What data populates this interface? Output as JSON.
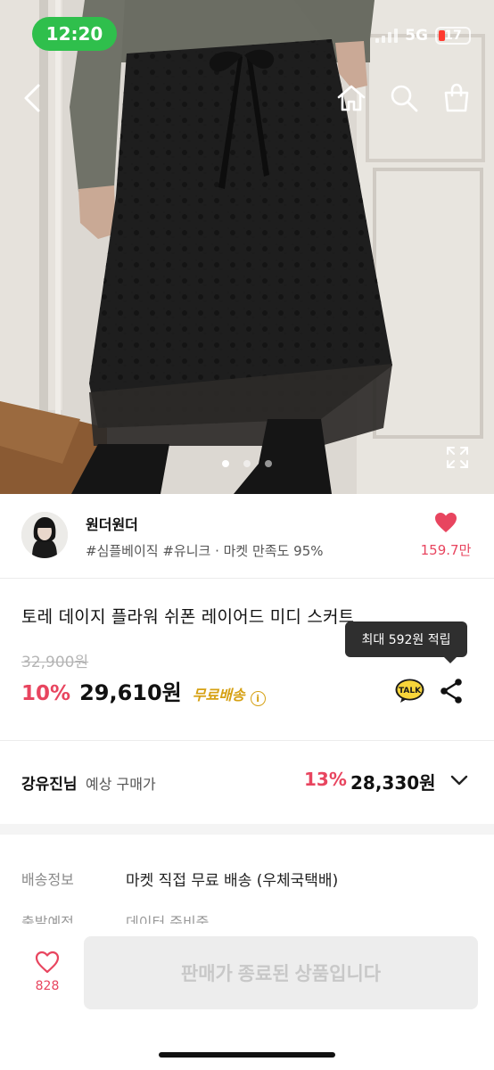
{
  "status_bar": {
    "time": "12:20",
    "network": "5G",
    "battery": "17"
  },
  "nav": {
    "back_icon": "chevron-left-icon",
    "home_icon": "home-icon",
    "search_icon": "search-icon",
    "cart_icon": "shopping-bag-icon"
  },
  "gallery": {
    "image_count": 3,
    "active_index": 0,
    "expand_icon": "expand-icon"
  },
  "seller": {
    "name": "원더원더",
    "tags": "#심플베이직 #유니크 · 마켓 만족도 95%",
    "likes": "159.7만"
  },
  "product": {
    "title": "토레 데이지 플라워 쉬폰 레이어드 미디 스커트",
    "original_price": "32,900원",
    "discount": "10%",
    "price": "29,610원",
    "shipping_badge": "무료배송",
    "points_tooltip": "최대 592원 적립"
  },
  "expected": {
    "user": "강유진님",
    "label": "예상 구매가",
    "discount": "13%",
    "price": "28,330원"
  },
  "shipping": {
    "label": "배송정보",
    "value": "마켓 직접 무료 배송 (우체국택배)",
    "next_label": "출발예정",
    "next_value": "데이터 준비중"
  },
  "bottom_bar": {
    "wish_count": "828",
    "buy_label": "판매가 종료된 상품입니다"
  },
  "colors": {
    "accent": "#e8455f",
    "shipping": "#d6a114",
    "status_time_bg": "#2fbf4c",
    "tooltip_bg": "#2f2f2f"
  }
}
